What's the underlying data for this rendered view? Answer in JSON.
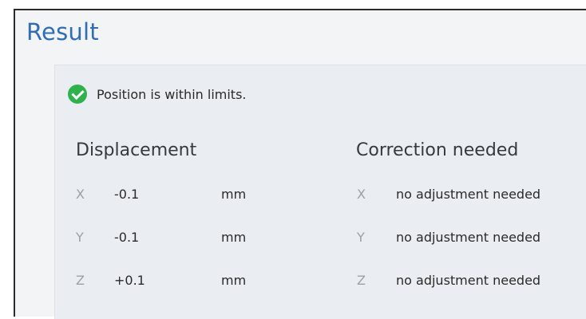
{
  "title": "Result",
  "status": {
    "icon": "check-circle-icon",
    "text": "Position is within limits.",
    "color": "#2fb24c"
  },
  "displacement": {
    "heading": "Displacement",
    "rows": [
      {
        "axis": "X",
        "value": "-0.1",
        "unit": "mm"
      },
      {
        "axis": "Y",
        "value": "-0.1",
        "unit": "mm"
      },
      {
        "axis": "Z",
        "value": "+0.1",
        "unit": "mm"
      }
    ]
  },
  "correction": {
    "heading": "Correction needed",
    "rows": [
      {
        "axis": "X",
        "text": "no adjustment needed"
      },
      {
        "axis": "Y",
        "text": "no adjustment needed"
      },
      {
        "axis": "Z",
        "text": "no adjustment needed"
      }
    ]
  },
  "colors": {
    "title": "#2f6db4",
    "axis_label": "#9aa1a8"
  }
}
